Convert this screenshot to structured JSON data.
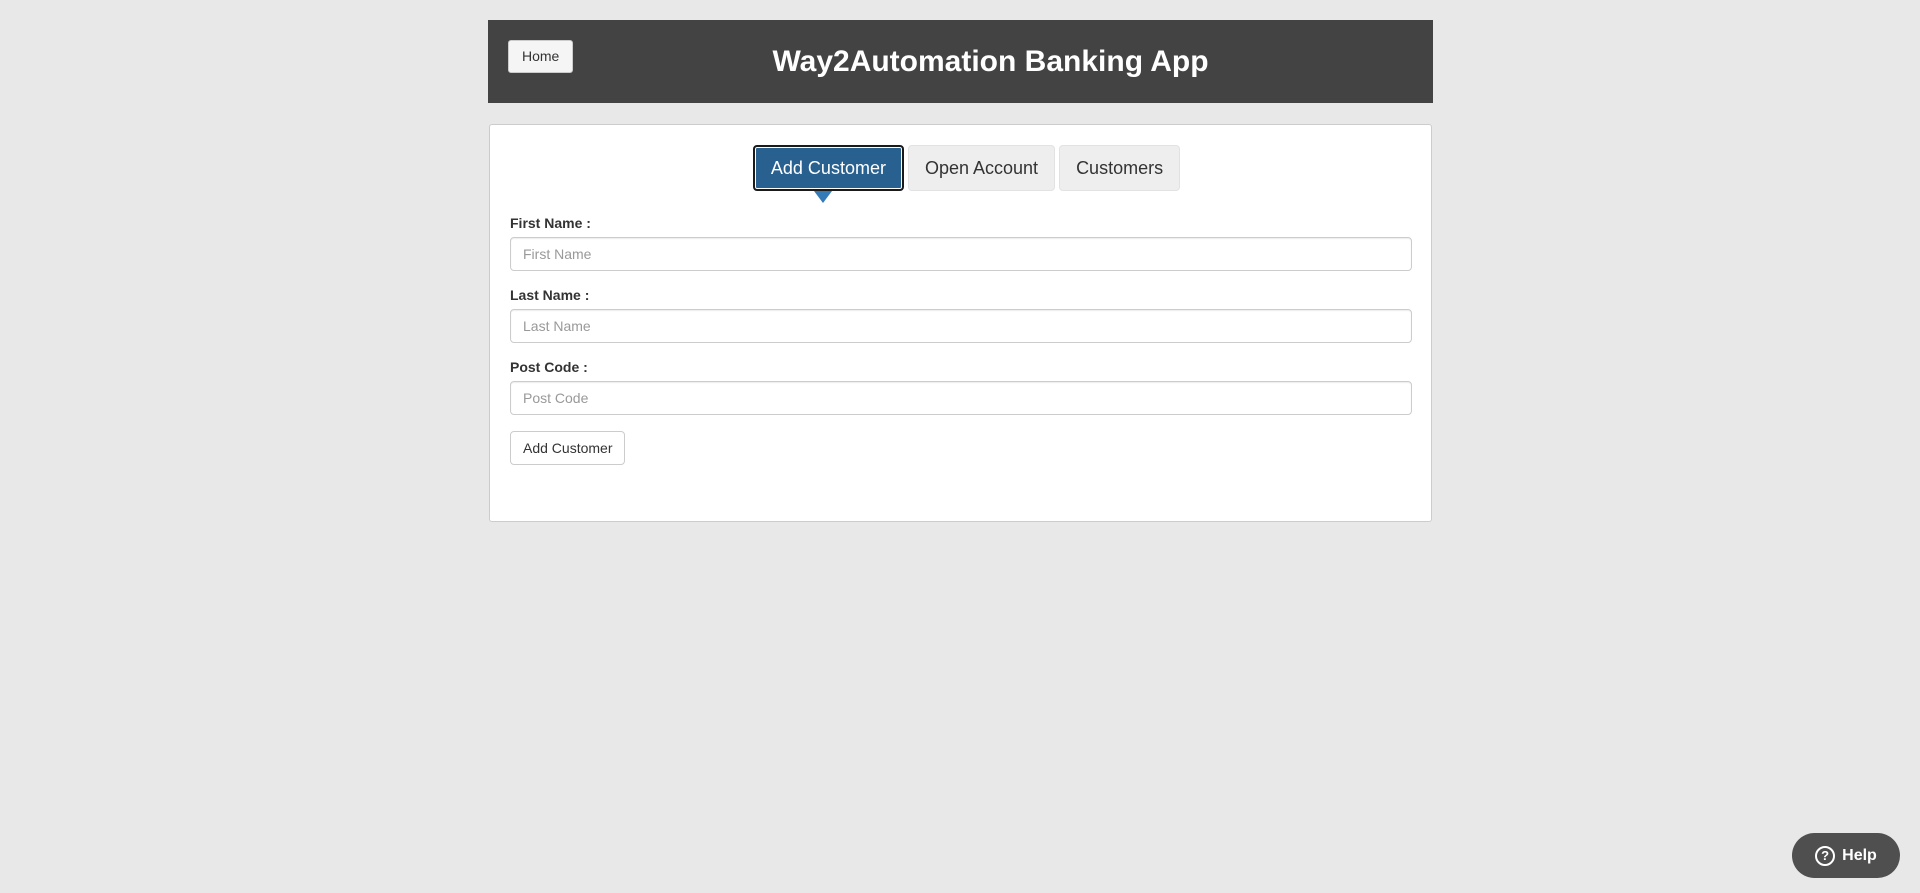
{
  "header": {
    "home_label": "Home",
    "title": "Way2Automation Banking App"
  },
  "tabs": [
    {
      "label": "Add Customer",
      "active": true
    },
    {
      "label": "Open Account",
      "active": false
    },
    {
      "label": "Customers",
      "active": false
    }
  ],
  "form": {
    "first_name": {
      "label": "First Name :",
      "placeholder": "First Name",
      "value": ""
    },
    "last_name": {
      "label": "Last Name :",
      "placeholder": "Last Name",
      "value": ""
    },
    "post_code": {
      "label": "Post Code :",
      "placeholder": "Post Code",
      "value": ""
    },
    "submit_label": "Add Customer"
  },
  "help": {
    "icon": "question-circle-icon",
    "glyph": "?",
    "label": "Help"
  },
  "colors": {
    "background": "#e8e8e8",
    "header": "#434343",
    "active_tab": "#286090",
    "tab_arrow": "#337ab7",
    "help_widget": "#4f4f4f"
  }
}
